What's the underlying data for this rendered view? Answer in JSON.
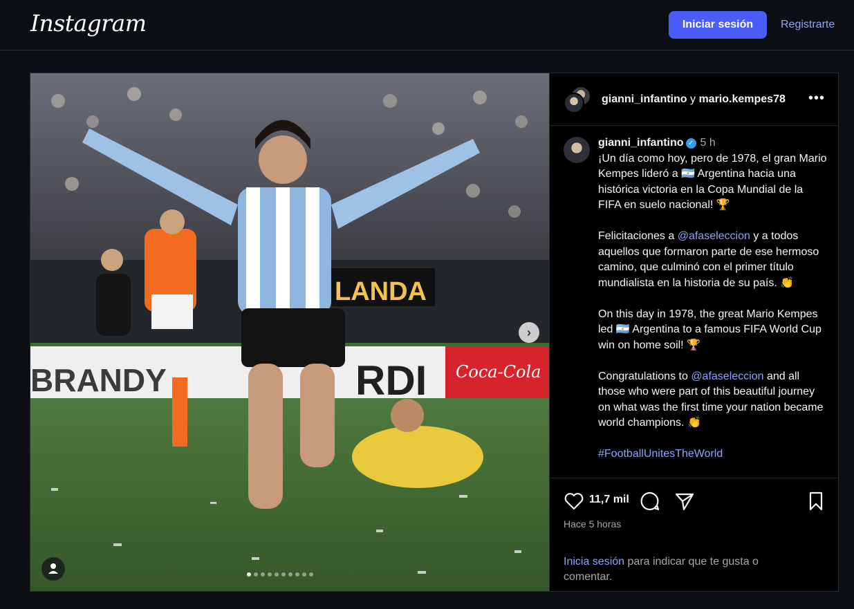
{
  "header": {
    "logo": "Instagram",
    "login_button": "Iniciar sesión",
    "register_link": "Registrarte"
  },
  "post": {
    "header": {
      "user1": "gianni_infantino",
      "conjunction": "y",
      "user2": "mario.kempes78",
      "more": "•••"
    },
    "media": {
      "stadium_banner_left": "BRANDY",
      "stadium_banner_mid": "RDI",
      "stadium_banner_right": "Coca-Cola",
      "scoreboard": "LANDA",
      "carousel_total": 10,
      "carousel_active": 1
    },
    "caption": {
      "username": "gianni_infantino",
      "verified": "✓",
      "time": "5 h",
      "p1": "¡Un día como hoy, pero de 1978, el gran Mario Kempes lideró a 🇦🇷 Argentina hacia una histórica victoria en la Copa Mundial de la FIFA en suelo nacional! 🏆",
      "p2_a": "Felicitaciones a ",
      "p2_mention": "@afaseleccion",
      "p2_b": " y a todos aquellos que formaron parte de ese hermoso camino, que culminó con el primer título mundialista en la historia de su país. 👏",
      "p3": "On this day in 1978, the great Mario Kempes led 🇦🇷 Argentina to a famous FIFA World Cup win on home soil! 🏆",
      "p4_a": "Congratulations to ",
      "p4_mention": "@afaseleccion",
      "p4_b": " and all those who were part of this beautiful journey on what was the first time your nation became world champions. 👏",
      "hashtag": "#FootballUnitesTheWorld"
    },
    "footer": {
      "likes": "11,7 mil",
      "posted_ago": "Hace 5 horas",
      "login_link": "Inicia sesión",
      "login_rest": " para indicar que te gusta o comentar."
    }
  },
  "icons": {
    "like": "heart-icon",
    "comment": "comment-icon",
    "share": "send-icon",
    "save": "bookmark-icon",
    "next": "chevron-right-icon",
    "tag": "user-icon"
  },
  "colors": {
    "background": "#0c0f14",
    "primary_button": "#4a5df9",
    "link": "#8fa2ff",
    "secondary_text": "#a8a8a8"
  }
}
